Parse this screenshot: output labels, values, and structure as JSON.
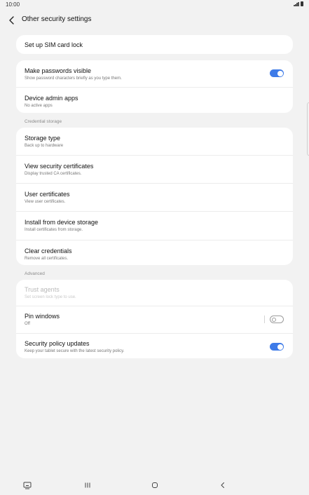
{
  "status": {
    "time": "10:00"
  },
  "header": {
    "title": "Other security settings"
  },
  "group1": {
    "sim_lock": "Set up SIM card lock"
  },
  "group2": {
    "make_passwords_visible": {
      "title": "Make passwords visible",
      "subtitle": "Show password characters briefly as you type them.",
      "toggle": "on"
    },
    "device_admin_apps": {
      "title": "Device admin apps",
      "subtitle": "No active apps"
    }
  },
  "credential_storage": {
    "label": "Credential storage",
    "items": [
      {
        "title": "Storage type",
        "subtitle": "Back up to hardware"
      },
      {
        "title": "View security certificates",
        "subtitle": "Display trusted CA certificates."
      },
      {
        "title": "User certificates",
        "subtitle": "View user certificates."
      },
      {
        "title": "Install from device storage",
        "subtitle": "Install certificates from storage."
      },
      {
        "title": "Clear credentials",
        "subtitle": "Remove all certificates."
      }
    ]
  },
  "advanced": {
    "label": "Advanced",
    "trust_agents": {
      "title": "Trust agents",
      "subtitle": "Set screen lock type to use."
    },
    "pin_windows": {
      "title": "Pin windows",
      "subtitle": "Off",
      "toggle": "off"
    },
    "security_policy_updates": {
      "title": "Security policy updates",
      "subtitle": "Keep your tablet secure with the latest security policy.",
      "toggle": "on"
    }
  },
  "colors": {
    "accent": "#3e7be8",
    "background": "#f2f2f2",
    "card": "#ffffff"
  },
  "navbar": {
    "icons": [
      "keyboard-icon",
      "recents-icon",
      "home-icon",
      "back-icon"
    ]
  }
}
